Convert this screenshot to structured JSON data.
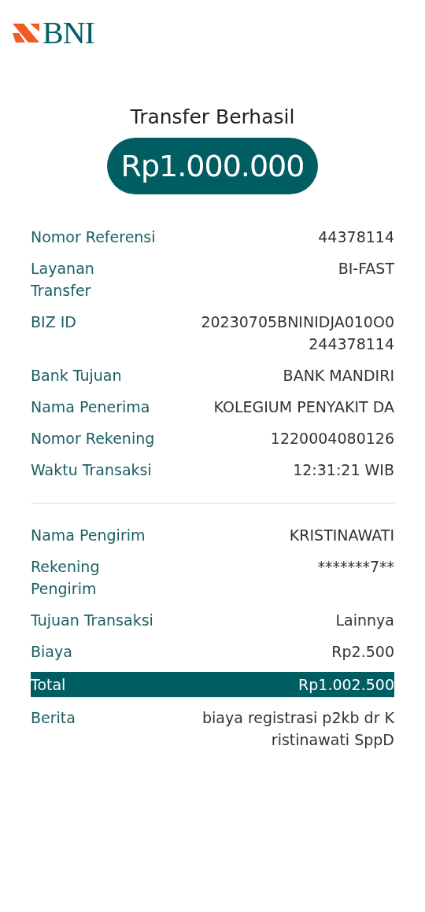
{
  "logo": {
    "text": "BNI"
  },
  "title": "Transfer Berhasil",
  "amount": "Rp1.000.000",
  "details": [
    {
      "label": "Nomor Referensi",
      "value": "44378114"
    },
    {
      "label": "Layanan Transfer",
      "value": "BI-FAST"
    },
    {
      "label": "BIZ ID",
      "value": "20230705BNINIDJA010O0244378114"
    },
    {
      "label": "Bank Tujuan",
      "value": "BANK MANDIRI"
    },
    {
      "label": "Nama Penerima",
      "value": "KOLEGIUM PENYAKIT DA"
    },
    {
      "label": "Nomor Rekening",
      "value": "1220004080126"
    },
    {
      "label": "Waktu Transaksi",
      "value": "12:31:21 WIB"
    }
  ],
  "sender": [
    {
      "label": "Nama Pengirim",
      "value": "KRISTINAWATI",
      "kind": "plain"
    },
    {
      "label": "Rekening Pengirim",
      "value": "*******7**",
      "kind": "plain"
    },
    {
      "label": "Tujuan Transaksi",
      "value": "Lainnya",
      "kind": "plain"
    },
    {
      "label": "Biaya",
      "value": "Rp2.500",
      "kind": "plain"
    },
    {
      "label": "Total",
      "value": "Rp1.002.500",
      "kind": "total"
    },
    {
      "label": "Berita",
      "value": "biaya registrasi p2kb dr Kristinawati SppD",
      "kind": "plain"
    }
  ]
}
